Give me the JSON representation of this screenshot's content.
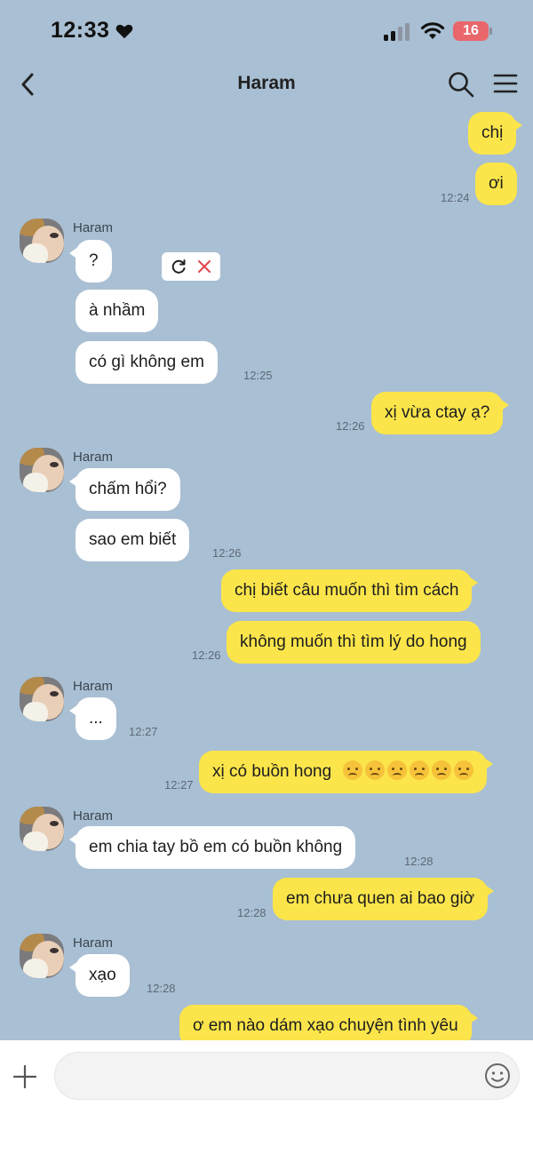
{
  "status_bar": {
    "time": "12:33",
    "battery": "16"
  },
  "header": {
    "title": "Haram"
  },
  "colors": {
    "background": "#a9bfd3",
    "my_bubble": "#fbe54a",
    "their_bubble": "#ffffff"
  },
  "messages": [
    {
      "from": "me",
      "text": "chị"
    },
    {
      "from": "me",
      "text": "ơi",
      "time": "12:24"
    },
    {
      "from": "them",
      "sender": "Haram",
      "text": "?",
      "status": "failed"
    },
    {
      "from": "them",
      "text": "à nhầm"
    },
    {
      "from": "them",
      "text": "có gì không em",
      "time": "12:25"
    },
    {
      "from": "me",
      "text": "xị vừa ctay ạ?",
      "time": "12:26"
    },
    {
      "from": "them",
      "sender": "Haram",
      "text": "chấm hổi?"
    },
    {
      "from": "them",
      "text": "sao em biết",
      "time": "12:26"
    },
    {
      "from": "me",
      "text": "chị biết câu muốn thì tìm cách"
    },
    {
      "from": "me",
      "text": "không muốn thì tìm lý do hong",
      "time": "12:26"
    },
    {
      "from": "them",
      "sender": "Haram",
      "text": "...",
      "time": "12:27"
    },
    {
      "from": "me",
      "text": "xị có buồn hong",
      "emojis": [
        "sad-emoji",
        "sad-emoji",
        "sad-emoji",
        "sad-emoji",
        "sad-emoji",
        "sad-emoji"
      ],
      "time": "12:27"
    },
    {
      "from": "them",
      "sender": "Haram",
      "text": "em chia tay bồ em có buồn không",
      "time": "12:28"
    },
    {
      "from": "me",
      "text": "em chưa quen ai bao giờ",
      "time": "12:28"
    },
    {
      "from": "them",
      "sender": "Haram",
      "text": "xạo",
      "time": "12:28"
    },
    {
      "from": "me",
      "text": "ơ em nào dám xạo chuyện tình yêu"
    }
  ]
}
